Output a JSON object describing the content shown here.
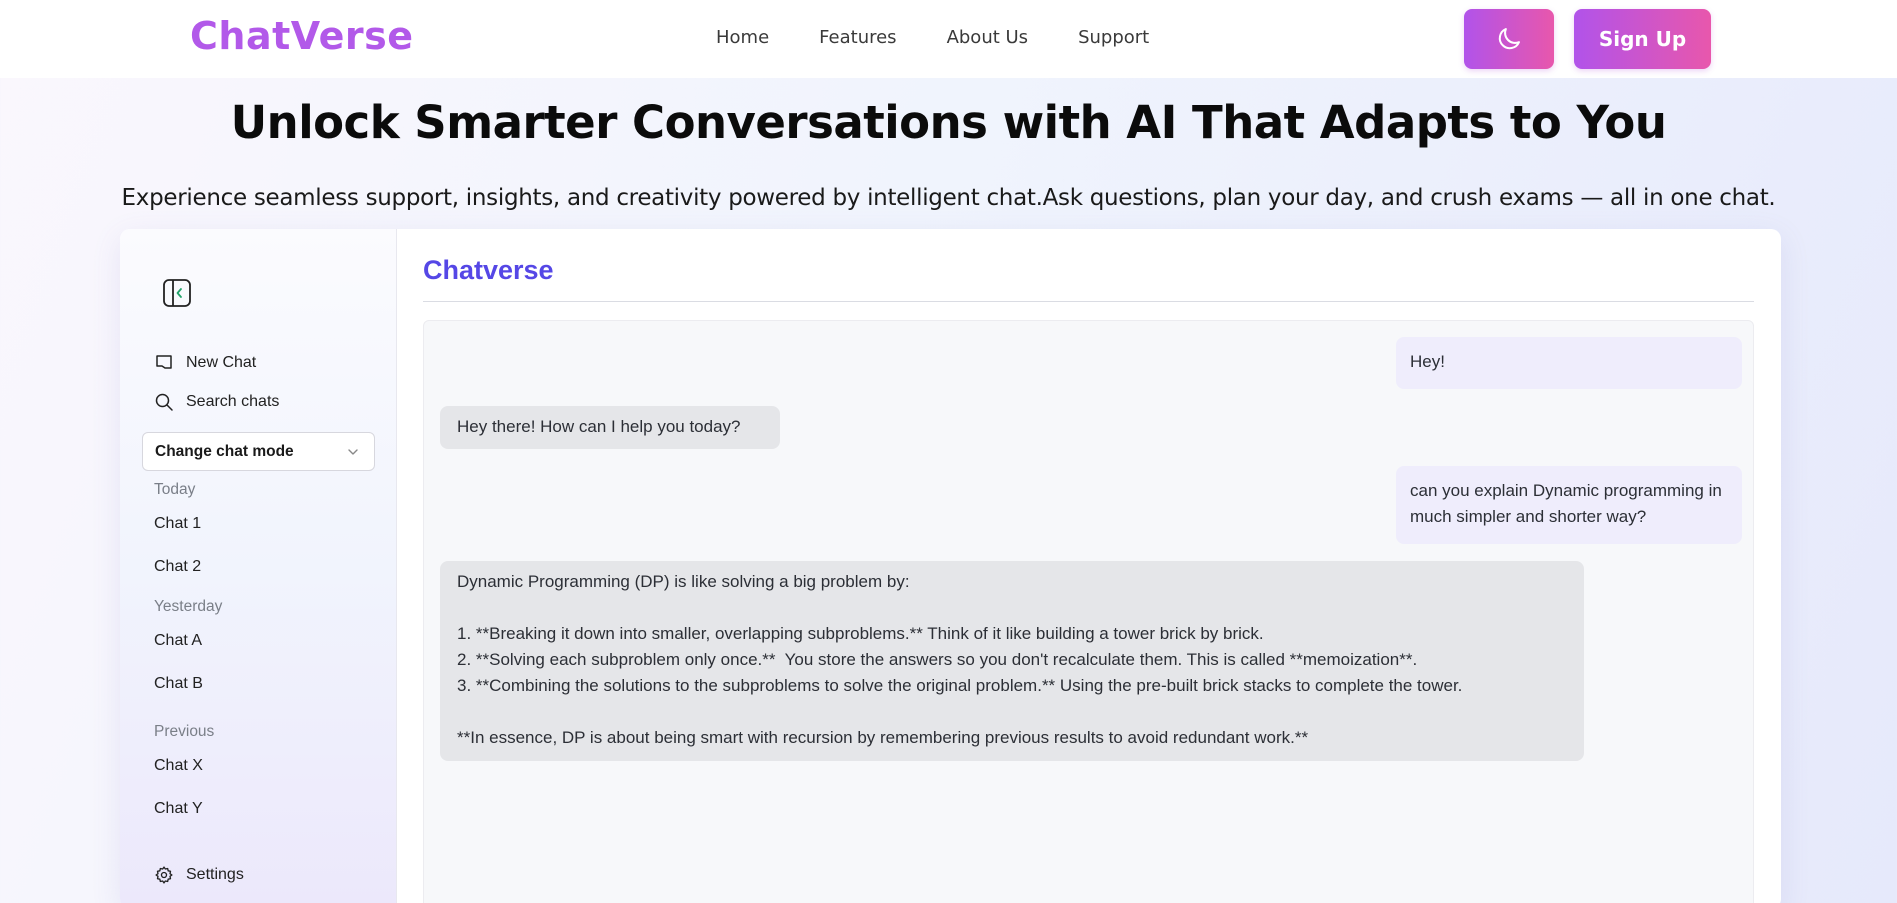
{
  "brand": "ChatVerse",
  "nav": {
    "links": [
      "Home",
      "Features",
      "About Us",
      "Support"
    ],
    "theme_icon": "moon-icon",
    "signup_label": "Sign Up"
  },
  "hero": {
    "title": "Unlock Smarter Conversations with AI That Adapts to You",
    "subtitle": "Experience seamless support, insights, and creativity powered by intelligent chat.Ask questions, plan your day, and crush exams — all in one chat."
  },
  "sidebar": {
    "collapse_icon": "sidebar-collapse-icon",
    "new_chat": "New Chat",
    "search_chats": "Search chats",
    "mode_select": "Change chat mode",
    "groups": [
      {
        "label": "Today",
        "items": [
          "Chat 1",
          "Chat 2"
        ]
      },
      {
        "label": "Yesterday",
        "items": [
          "Chat A",
          "Chat B"
        ]
      },
      {
        "label": "Previous",
        "items": [
          "Chat X",
          "Chat Y"
        ]
      }
    ],
    "settings": "Settings"
  },
  "main": {
    "title": "Chatverse",
    "messages": [
      {
        "role": "user",
        "text": "Hey!"
      },
      {
        "role": "bot",
        "text": "Hey there! How can I help you today?"
      },
      {
        "role": "user",
        "text": "can you explain Dynamic programming in much simpler and shorter way?"
      },
      {
        "role": "bot",
        "lines": [
          "Dynamic Programming (DP) is like solving a big problem by:",
          "",
          "1. **Breaking it down into smaller, overlapping subproblems.** Think of it like building a tower brick by brick.",
          "2. **Solving each subproblem only once.**  You store the answers so you don't recalculate them. This is called **memoization**.",
          "3. **Combining the solutions to the subproblems to solve the original problem.** Using the pre-built brick stacks to complete the tower.",
          "",
          "**In essence, DP is about being smart with recursion by remembering previous results to avoid redundant work.**"
        ]
      }
    ]
  },
  "colors": {
    "brand": "#b259e9",
    "accent_gradient_start": "#b153ea",
    "accent_gradient_end": "#e857ac",
    "chat_title": "#5547e6"
  }
}
